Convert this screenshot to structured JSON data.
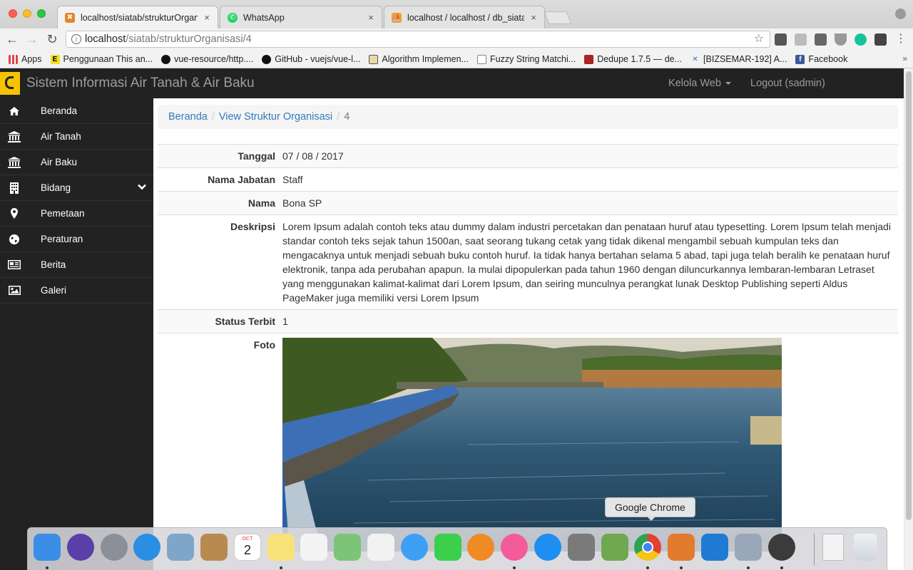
{
  "browser": {
    "tabs": [
      {
        "title": "localhost/siatab/strukturOrgan",
        "active": true,
        "favicon_color": "#e8832a"
      },
      {
        "title": "WhatsApp",
        "active": false,
        "favicon_color": "#25d366"
      },
      {
        "title": "localhost / localhost / db_siatab",
        "active": false,
        "favicon_color": "#f0a030"
      }
    ],
    "close_glyph": "×",
    "url_host": "localhost",
    "url_path": "/siatab/strukturOrganisasi/4",
    "bookmarks": [
      {
        "label": "Apps",
        "icon": "apps-grid-icon",
        "color": "#d44"
      },
      {
        "label": "Penggunaan This an...",
        "icon": "E",
        "color": "#f7df1e"
      },
      {
        "label": "vue-resource/http....",
        "icon": "github-icon",
        "color": "#111"
      },
      {
        "label": "GitHub - vuejs/vue-l...",
        "icon": "github-icon",
        "color": "#111"
      },
      {
        "label": "Algorithm Implemen...",
        "icon": "book-icon",
        "color": "#444"
      },
      {
        "label": "Fuzzy String Matchi...",
        "icon": "page-icon",
        "color": "#888"
      },
      {
        "label": "Dedupe 1.7.5 — de...",
        "icon": "dedupe-icon",
        "color": "#a22"
      },
      {
        "label": "[BIZSEMAR-192] A...",
        "icon": "jira-icon",
        "color": "#3572b0"
      },
      {
        "label": "Facebook",
        "icon": "f",
        "color": "#3b5998"
      }
    ]
  },
  "app": {
    "brand": "Sistem Informasi Air Tanah & Air Baku",
    "menu_kelola": "Kelola Web",
    "menu_logout": "Logout (sadmin)"
  },
  "sidebar": {
    "items": [
      {
        "label": "Beranda",
        "icon": "home-icon"
      },
      {
        "label": "Air Tanah",
        "icon": "institution-icon"
      },
      {
        "label": "Air Baku",
        "icon": "institution-icon"
      },
      {
        "label": "Bidang",
        "icon": "building-icon",
        "has_submenu": true
      },
      {
        "label": "Pemetaan",
        "icon": "map-marker-icon"
      },
      {
        "label": "Peraturan",
        "icon": "globe-icon"
      },
      {
        "label": "Berita",
        "icon": "newspaper-icon"
      },
      {
        "label": "Galeri",
        "icon": "image-icon"
      }
    ]
  },
  "breadcrumb": {
    "home": "Beranda",
    "parent": "View Struktur Organisasi",
    "current": "4"
  },
  "detail": {
    "tanggal_label": "Tanggal",
    "tanggal_value": "07 / 08 / 2017",
    "jabatan_label": "Nama Jabatan",
    "jabatan_value": "Staff",
    "nama_label": "Nama",
    "nama_value": "Bona SP",
    "deskripsi_label": "Deskripsi",
    "deskripsi_value": "Lorem Ipsum adalah contoh teks atau dummy dalam industri percetakan dan penataan huruf atau typesetting. Lorem Ipsum telah menjadi standar contoh teks sejak tahun 1500an, saat seorang tukang cetak yang tidak dikenal mengambil sebuah kumpulan teks dan mengacaknya untuk menjadi sebuah buku contoh huruf. Ia tidak hanya bertahan selama 5 abad, tapi juga telah beralih ke penataan huruf elektronik, tanpa ada perubahan apapun. Ia mulai dipopulerkan pada tahun 1960 dengan diluncurkannya lembaran-lembaran Letraset yang menggunakan kalimat-kalimat dari Lorem Ipsum, dan seiring munculnya perangkat lunak Desktop Publishing seperti Aldus PageMaker juga memiliki versi Lorem Ipsum",
    "status_label": "Status Terbit",
    "status_value": "1",
    "foto_label": "Foto"
  },
  "dock": {
    "tooltip": "Google Chrome",
    "calendar_month": "OCT",
    "calendar_day": "2",
    "apps": [
      {
        "name": "finder-icon",
        "color": "#3a8ee6",
        "running": true
      },
      {
        "name": "siri-icon",
        "color": "#5a3fa8",
        "running": false
      },
      {
        "name": "launchpad-icon",
        "color": "#8a8f98",
        "running": false
      },
      {
        "name": "safari-icon",
        "color": "#2a8fe3",
        "running": false
      },
      {
        "name": "preview-icon",
        "color": "#7ea6c8",
        "running": false
      },
      {
        "name": "notefile-icon",
        "color": "#b98a4f",
        "running": false
      },
      {
        "name": "calendar-icon",
        "color": "#ffffff",
        "running": false
      },
      {
        "name": "notes-icon",
        "color": "#f7e27a",
        "running": true
      },
      {
        "name": "reminders-icon",
        "color": "#f4f4f4",
        "running": false
      },
      {
        "name": "maps-icon",
        "color": "#7cc576",
        "running": false
      },
      {
        "name": "photos-icon",
        "color": "#f2f2f2",
        "running": false
      },
      {
        "name": "messages-icon",
        "color": "#3ea0f5",
        "running": false
      },
      {
        "name": "facetime-icon",
        "color": "#3ccf4e",
        "running": false
      },
      {
        "name": "ibooks-icon",
        "color": "#f08a24",
        "running": false
      },
      {
        "name": "itunes-icon",
        "color": "#f45b9a",
        "running": true
      },
      {
        "name": "app-store-icon",
        "color": "#1e8ef0",
        "running": false
      },
      {
        "name": "system-preferences-icon",
        "color": "#7a7a7a",
        "running": false
      },
      {
        "name": "android-studio-icon",
        "color": "#6fa84f",
        "running": false
      },
      {
        "name": "chrome-icon",
        "color": "#e34133",
        "running": true
      },
      {
        "name": "paint-icon",
        "color": "#e27b2e",
        "running": true
      },
      {
        "name": "vscode-icon",
        "color": "#1f7ad4",
        "running": false
      },
      {
        "name": "settings-gear-icon",
        "color": "#9aa7b8",
        "running": true
      },
      {
        "name": "quicktime-icon",
        "color": "#3b3b3b",
        "running": true
      }
    ]
  },
  "colors": {
    "accent_link": "#337ab7",
    "navbar_bg": "#222222",
    "logo_yellow": "#f5c400"
  }
}
